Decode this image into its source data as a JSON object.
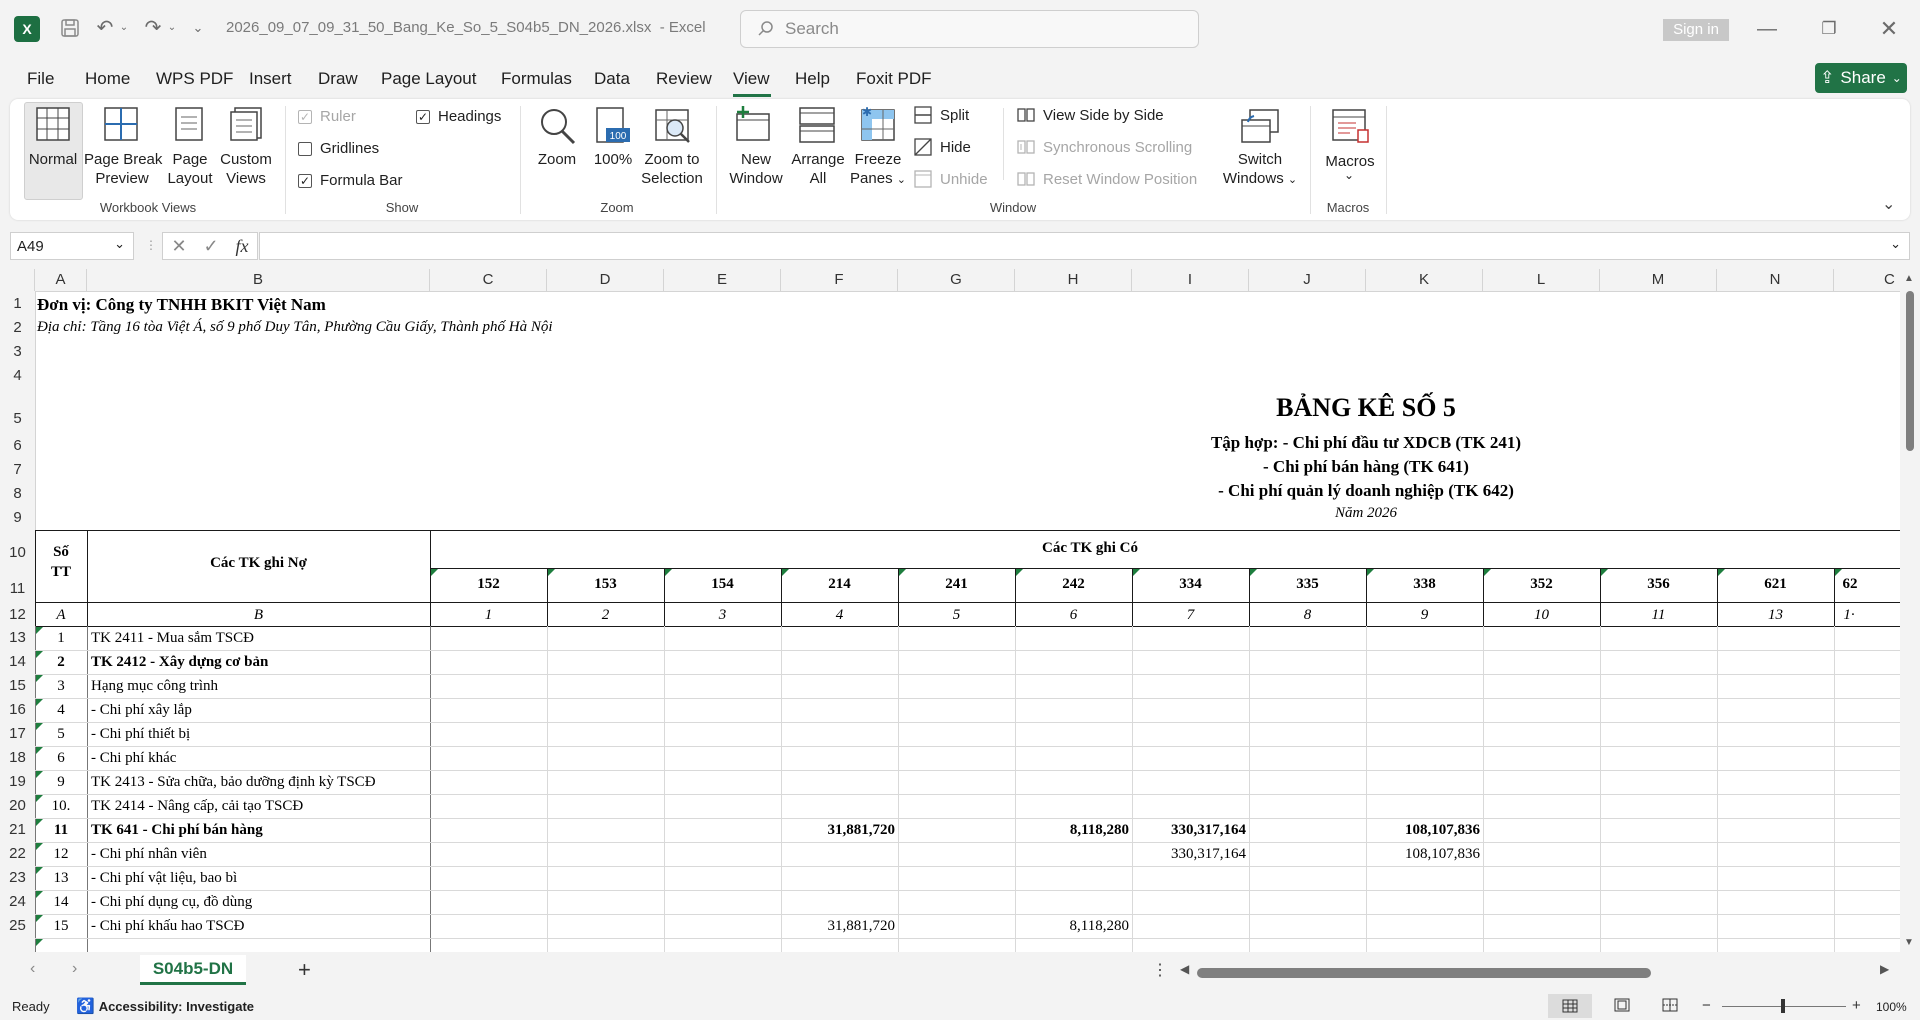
{
  "titlebar": {
    "filename": "2026_09_07_09_31_50_Bang_Ke_So_5_S04b5_DN_2026.xlsx",
    "app_suffix": "-  Excel",
    "search_placeholder": "Search",
    "signin_label": "Sign in"
  },
  "menu": {
    "items": [
      "File",
      "Home",
      "WPS PDF",
      "Insert",
      "Draw",
      "Page Layout",
      "Formulas",
      "Data",
      "Review",
      "View",
      "Help",
      "Foxit PDF"
    ],
    "active": "View",
    "share_label": "Share"
  },
  "ribbon": {
    "workbook_views": {
      "group_label": "Workbook Views",
      "normal": "Normal",
      "page_break_1": "Page Break",
      "page_break_2": "Preview",
      "page_layout_1": "Page",
      "page_layout_2": "Layout",
      "custom_views_1": "Custom",
      "custom_views_2": "Views"
    },
    "show": {
      "group_label": "Show",
      "ruler": "Ruler",
      "headings": "Headings",
      "gridlines": "Gridlines",
      "formula_bar": "Formula Bar"
    },
    "zoom": {
      "group_label": "Zoom",
      "zoom": "Zoom",
      "hundred": "100%",
      "zoom_sel_1": "Zoom to",
      "zoom_sel_2": "Selection",
      "hundred_icon_text": "100"
    },
    "window": {
      "group_label": "Window",
      "new_window_1": "New",
      "new_window_2": "Window",
      "arrange_1": "Arrange",
      "arrange_2": "All",
      "freeze_1": "Freeze",
      "freeze_2": "Panes",
      "split": "Split",
      "hide": "Hide",
      "unhide": "Unhide",
      "side_by_side": "View Side by Side",
      "sync_scroll": "Synchronous Scrolling",
      "reset_pos": "Reset Window Position",
      "switch_1": "Switch",
      "switch_2": "Windows"
    },
    "macros": {
      "group_label": "Macros",
      "macros": "Macros"
    }
  },
  "formula_bar": {
    "name_box": "A49",
    "fx": "fx",
    "content": ""
  },
  "sheet": {
    "columns": [
      "A",
      "B",
      "C",
      "D",
      "E",
      "F",
      "G",
      "H",
      "I",
      "J",
      "K",
      "L",
      "M",
      "N",
      "C"
    ],
    "row_numbers": [
      "1",
      "2",
      "3",
      "4",
      "5",
      "6",
      "7",
      "8",
      "9",
      "10",
      "11",
      "12",
      "13",
      "14",
      "15",
      "16",
      "17",
      "18",
      "19",
      "20",
      "21",
      "22",
      "23",
      "24",
      "25"
    ],
    "unit_line": "Đơn vị: Công ty TNHH BKIT Việt Nam",
    "address_line": "Địa chỉ: Tầng 16 tòa Việt Á, số 9 phố Duy Tân, Phường Cầu Giấy, Thành phố Hà Nội",
    "title": "BẢNG KÊ SỐ 5",
    "subtitle_1": "Tập hợp: - Chi phí đầu tư XDCB (TK 241)",
    "subtitle_2": "- Chi phí bán hàng (TK 641)",
    "subtitle_3": "- Chi phí quản lý doanh nghiệp (TK 642)",
    "year": "Năm 2026",
    "header_stt_1": "Số",
    "header_stt_2": "TT",
    "header_debit": "Các TK ghi Nợ",
    "header_credit": "Các TK ghi Có",
    "accounts": [
      "152",
      "153",
      "154",
      "214",
      "241",
      "242",
      "334",
      "335",
      "338",
      "352",
      "356",
      "621",
      "62"
    ],
    "index_row": [
      "A",
      "B",
      "1",
      "2",
      "3",
      "4",
      "5",
      "6",
      "7",
      "8",
      "9",
      "10",
      "11",
      "13",
      "1·"
    ],
    "rows": [
      {
        "stt": "1",
        "name": "TK 2411 - Mua sắm TSCĐ",
        "bold": false,
        "F": "",
        "H": "",
        "I": "",
        "K": ""
      },
      {
        "stt": "2",
        "name": "TK 2412 - Xây dựng cơ bản",
        "bold": true,
        "F": "",
        "H": "",
        "I": "",
        "K": ""
      },
      {
        "stt": "3",
        "name": "Hạng mục công trình",
        "bold": false,
        "F": "",
        "H": "",
        "I": "",
        "K": ""
      },
      {
        "stt": "4",
        "name": "- Chi phí xây lắp",
        "bold": false,
        "F": "",
        "H": "",
        "I": "",
        "K": ""
      },
      {
        "stt": "5",
        "name": "- Chi phí thiết bị",
        "bold": false,
        "F": "",
        "H": "",
        "I": "",
        "K": ""
      },
      {
        "stt": "6",
        "name": "- Chi phí khác",
        "bold": false,
        "F": "",
        "H": "",
        "I": "",
        "K": ""
      },
      {
        "stt": "9",
        "name": "TK 2413 - Sửa chữa, bảo dưỡng định kỳ TSCĐ",
        "bold": false,
        "F": "",
        "H": "",
        "I": "",
        "K": ""
      },
      {
        "stt": "10.",
        "name": "TK 2414 - Nâng cấp, cải tạo TSCĐ",
        "bold": false,
        "F": "",
        "H": "",
        "I": "",
        "K": ""
      },
      {
        "stt": "11",
        "name": "TK 641 - Chi phí bán hàng",
        "bold": true,
        "F": "31,881,720",
        "H": "8,118,280",
        "I": "330,317,164",
        "K": "108,107,836"
      },
      {
        "stt": "12",
        "name": "- Chi phí nhân viên",
        "bold": false,
        "F": "",
        "H": "",
        "I": "330,317,164",
        "K": "108,107,836"
      },
      {
        "stt": "13",
        "name": "- Chi phí vật liệu, bao bì",
        "bold": false,
        "F": "",
        "H": "",
        "I": "",
        "K": ""
      },
      {
        "stt": "14",
        "name": "- Chi phí dụng cụ, đồ dùng",
        "bold": false,
        "F": "",
        "H": "",
        "I": "",
        "K": ""
      },
      {
        "stt": "15",
        "name": "- Chi phí khấu hao TSCĐ",
        "bold": false,
        "F": "31,881,720",
        "H": "8,118,280",
        "I": "",
        "K": ""
      }
    ]
  },
  "tabs": {
    "sheet_name": "S04b5-DN",
    "add": "+"
  },
  "status": {
    "ready": "Ready",
    "accessibility": "Accessibility: Investigate",
    "zoom": "100%"
  }
}
